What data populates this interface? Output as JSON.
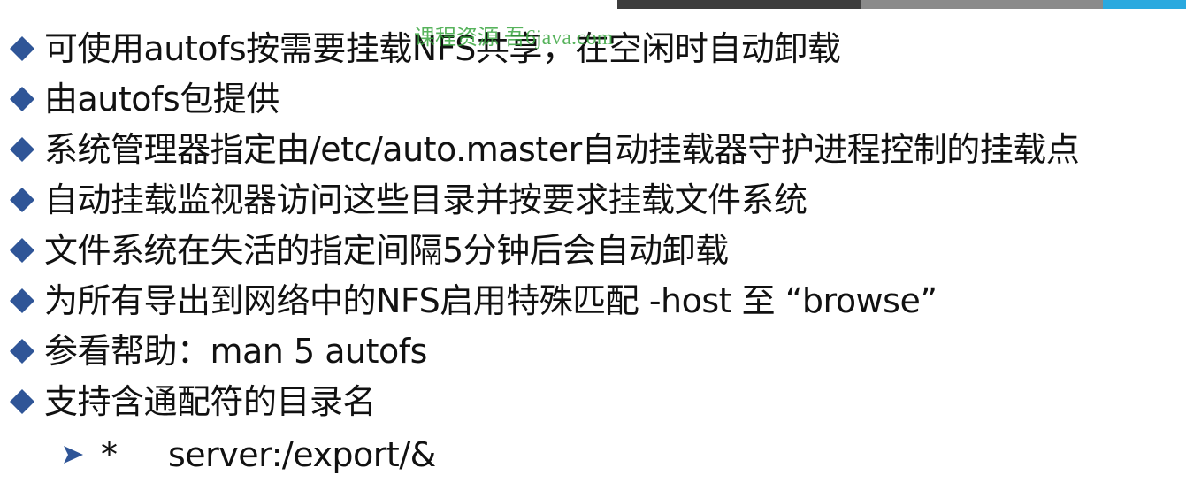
{
  "colors": {
    "bullet": "#2f5597",
    "text": "#111111",
    "watermark": "#3aa640",
    "strip_dark": "#3d3d3d",
    "strip_gray": "#8a8a8a",
    "strip_blue": "#2aa9df"
  },
  "icons": {
    "bullet": "diamond-icon",
    "sub_bullet": "arrow-right-icon"
  },
  "watermark": "课程资源  吾6java.com",
  "bullets": [
    "可使用autofs按需要挂载NFS共享，在空闲时自动卸载",
    "由autofs包提供",
    "系统管理器指定由/etc/auto.master自动挂载器守护进程控制的挂载点",
    "自动挂载监视器访问这些目录并按要求挂载文件系统",
    "文件系统在失活的指定间隔5分钟后会自动卸载",
    "为所有导出到网络中的NFS启用特殊匹配 -host 至 “browse”",
    "参看帮助：man 5 autofs",
    "支持含通配符的目录名"
  ],
  "sub_bullet": {
    "key": "*",
    "value": "server:/export/&"
  }
}
